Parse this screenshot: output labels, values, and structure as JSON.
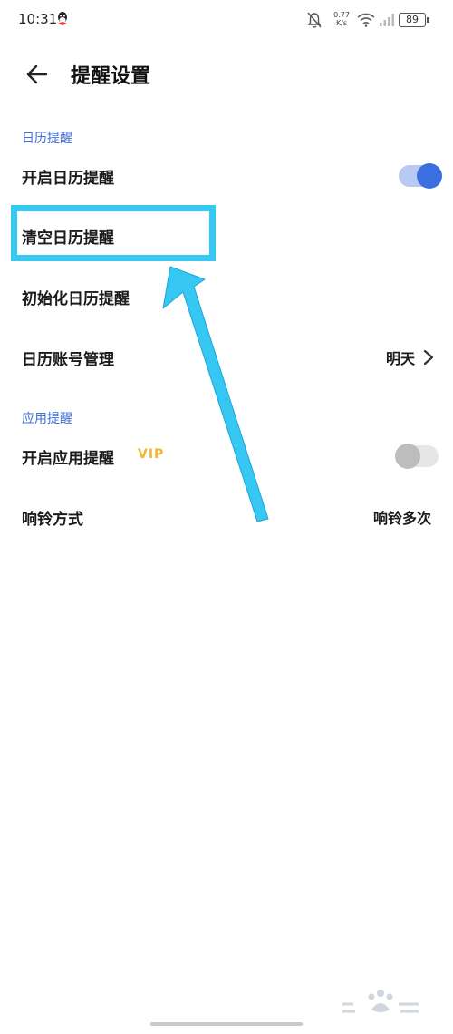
{
  "status_bar": {
    "time": "10:31",
    "speed_value": "0.77",
    "speed_unit": "K/s",
    "battery": "89"
  },
  "header": {
    "title": "提醒设置"
  },
  "sections": {
    "calendar": {
      "title": "日历提醒",
      "enable_label": "开启日历提醒",
      "enable_on": true,
      "clear_label": "清空日历提醒",
      "init_label": "初始化日历提醒",
      "account_label": "日历账号管理",
      "account_value": "明天"
    },
    "app": {
      "title": "应用提醒",
      "enable_label": "开启应用提醒",
      "vip": "VIP",
      "enable_on": false,
      "ring_label": "响铃方式",
      "ring_value": "响铃多次"
    }
  },
  "colors": {
    "accent": "#3b6fe0",
    "section_title": "#3f6fd8",
    "vip": "#f0b730",
    "highlight": "#36c7f3"
  }
}
